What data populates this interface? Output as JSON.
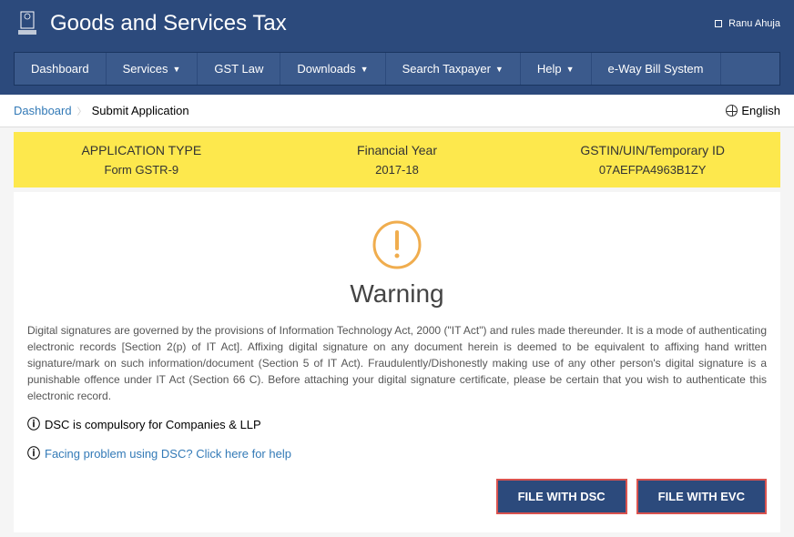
{
  "header": {
    "title": "Goods and Services Tax",
    "user": "Ranu Ahuja"
  },
  "nav": {
    "items": [
      {
        "label": "Dashboard",
        "dropdown": false
      },
      {
        "label": "Services",
        "dropdown": true
      },
      {
        "label": "GST Law",
        "dropdown": false
      },
      {
        "label": "Downloads",
        "dropdown": true
      },
      {
        "label": "Search Taxpayer",
        "dropdown": true
      },
      {
        "label": "Help",
        "dropdown": true
      },
      {
        "label": "e-Way Bill System",
        "dropdown": false
      }
    ]
  },
  "breadcrumb": {
    "link": "Dashboard",
    "current": "Submit Application"
  },
  "language": "English",
  "info": {
    "col1_label": "APPLICATION TYPE",
    "col1_value": "Form GSTR-9",
    "col2_label": "Financial Year",
    "col2_value": "2017-18",
    "col3_label": "GSTIN/UIN/Temporary ID",
    "col3_value": "07AEFPA4963B1ZY"
  },
  "warning": {
    "title": "Warning",
    "text": "Digital signatures are governed by the provisions of Information Technology Act, 2000 (\"IT Act\") and rules made thereunder. It is a mode of authenticating electronic records [Section 2(p) of IT Act]. Affixing digital signature on any document herein is deemed to be equivalent to affixing hand written signature/mark on such information/document (Section 5 of IT Act). Fraudulently/Dishonestly making use of any other person's digital signature is a punishable offence under IT Act (Section 66 C). Before attaching your digital signature certificate, please be certain that you wish to authenticate this electronic record.",
    "note": "DSC is compulsory for Companies & LLP",
    "help_link": "Facing problem using DSC? Click here for help"
  },
  "buttons": {
    "dsc": "FILE WITH DSC",
    "evc": "FILE WITH EVC"
  }
}
